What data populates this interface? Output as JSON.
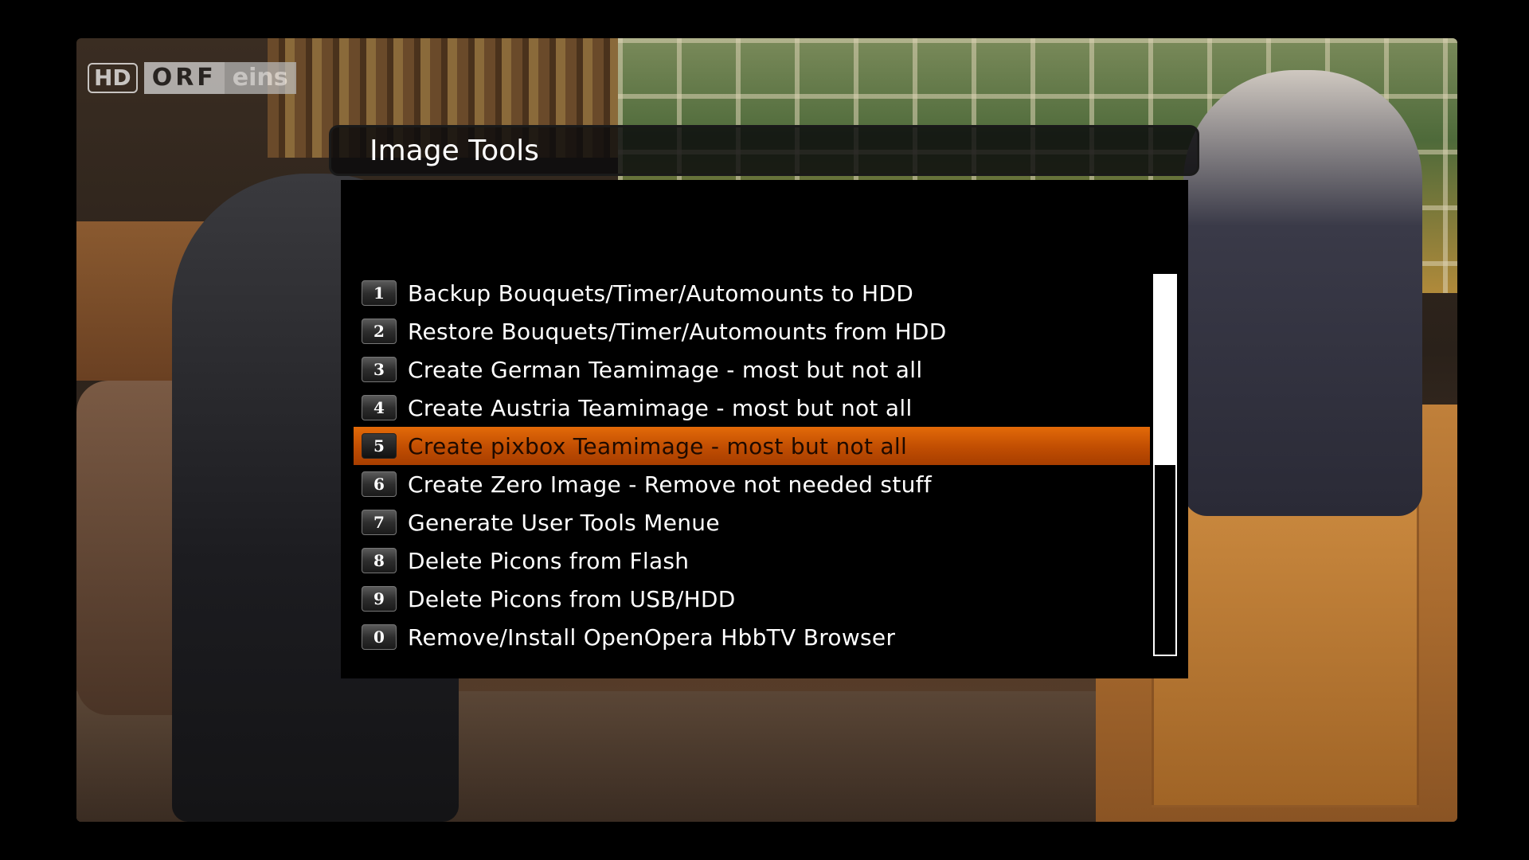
{
  "channel_logo": {
    "hd": "HD",
    "orf": "ORF",
    "eins": "eins"
  },
  "menu": {
    "title": "Image Tools",
    "selected_index": 4,
    "items": [
      {
        "key": "1",
        "label": "Backup Bouquets/Timer/Automounts to HDD"
      },
      {
        "key": "2",
        "label": "Restore Bouquets/Timer/Automounts from HDD"
      },
      {
        "key": "3",
        "label": "Create German Teamimage - most but not all"
      },
      {
        "key": "4",
        "label": "Create Austria Teamimage - most but not all"
      },
      {
        "key": "5",
        "label": "Create pixbox Teamimage - most but not all"
      },
      {
        "key": "6",
        "label": "Create Zero Image - Remove not needed stuff"
      },
      {
        "key": "7",
        "label": "Generate User Tools Menue"
      },
      {
        "key": "8",
        "label": "Delete Picons from Flash"
      },
      {
        "key": "9",
        "label": "Delete Picons from USB/HDD"
      },
      {
        "key": "0",
        "label": "Remove/Install OpenOpera HbbTV Browser"
      }
    ],
    "scroll_position_fraction": 0.5
  },
  "colors": {
    "highlight": "#c04d02",
    "background": "#000000",
    "text": "#ffffff"
  }
}
